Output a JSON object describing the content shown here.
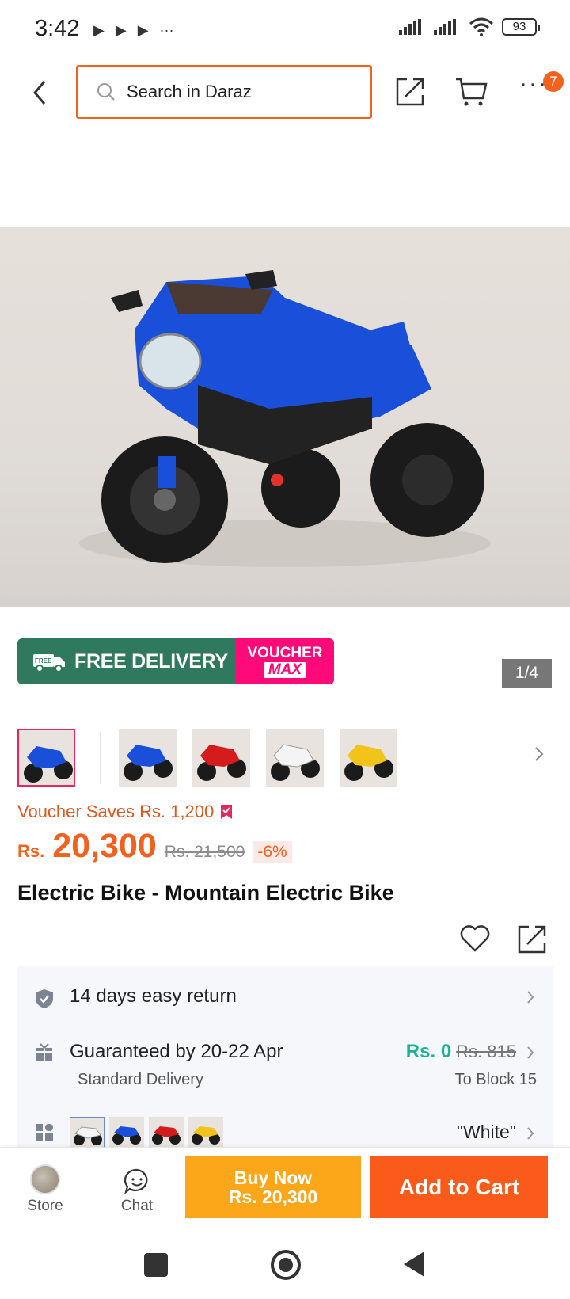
{
  "status": {
    "time": "3:42",
    "notif_icons": [
      "▶",
      "▶",
      "▶",
      "···"
    ],
    "battery": "93"
  },
  "topbar": {
    "search_placeholder": "Search in Daraz",
    "cart_badge": "7"
  },
  "gallery": {
    "pager": "1/4",
    "thumbnails": [
      "blue-bike",
      "blue-bike",
      "red-bike",
      "white-bike",
      "yellow-bike"
    ]
  },
  "promo": {
    "free_label": "FREE",
    "free_delivery": "FREE DELIVERY",
    "voucher_a": "VOUCHER",
    "voucher_b": "MAX"
  },
  "price": {
    "voucher_saves": "Voucher Saves Rs. 1,200",
    "currency": "Rs.",
    "current": "20,300",
    "original": "Rs. 21,500",
    "discount": "-6%"
  },
  "product": {
    "title": "Electric Bike - Mountain Electric Bike"
  },
  "info": {
    "return_text": "14 days easy return",
    "guarantee_text": "Guaranteed by 20-22 Apr",
    "delivery_type": "Standard Delivery",
    "fee": "Rs. 0",
    "fee_old": "Rs. 815",
    "location": "To Block 15",
    "variant_value": "\"White\""
  },
  "bottom": {
    "store_label": "Store",
    "chat_label": "Chat",
    "buy_now": "Buy Now",
    "buy_price": "Rs. 20,300",
    "add_to_cart": "Add to Cart"
  },
  "colors": {
    "accent": "#f2611d",
    "buy_now": "#fca71a",
    "add_to_cart": "#fa5b1a",
    "free_delivery": "#2f7a5e",
    "voucher": "#ff0a78",
    "free_fee": "#1ab394"
  }
}
